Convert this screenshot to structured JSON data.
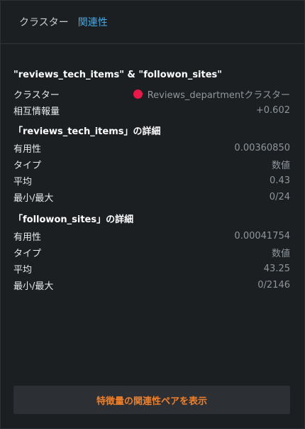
{
  "tabs": [
    {
      "label": "クラスター"
    },
    {
      "label": "関連性"
    }
  ],
  "pair_title": "\"reviews_tech_items\" & \"followon_sites\"",
  "summary": {
    "cluster_label": "クラスター",
    "cluster_value": "Reviews_departmentクラスター",
    "cluster_color": "#e8194a",
    "mi_label": "相互情報量",
    "mi_value": "+0.602"
  },
  "features": [
    {
      "title": "「reviews_tech_items」の詳細",
      "rows": [
        {
          "label": "有用性",
          "value": "0.00360850"
        },
        {
          "label": "タイプ",
          "value": "数値"
        },
        {
          "label": "平均",
          "value": "0.43"
        },
        {
          "label": "最小/最大",
          "value": "0/24"
        }
      ]
    },
    {
      "title": "「followon_sites」の詳細",
      "rows": [
        {
          "label": "有用性",
          "value": "0.00041754"
        },
        {
          "label": "タイプ",
          "value": "数値"
        },
        {
          "label": "平均",
          "value": "43.25"
        },
        {
          "label": "最小/最大",
          "value": "0/2146"
        }
      ]
    }
  ],
  "footer_button": "特徴量の関連性ペアを表示"
}
